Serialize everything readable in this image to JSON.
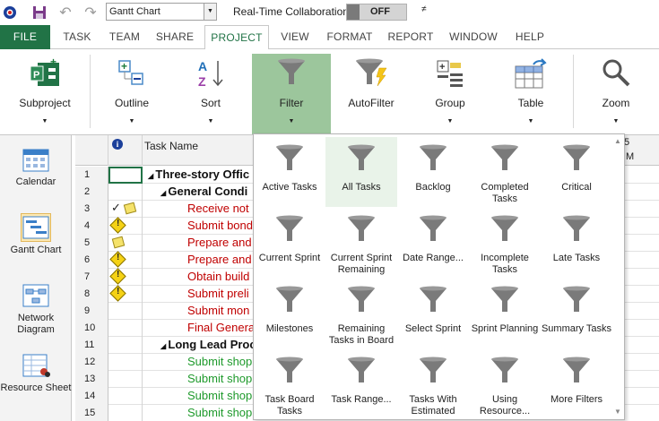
{
  "qat": {
    "view_select_value": "Gantt Chart",
    "realtime_label": "Real-Time Collaboration",
    "realtime_state": "OFF",
    "more_glyph": "≠"
  },
  "tabs": [
    "FILE",
    "TASK",
    "TEAM",
    "SHARE",
    "PROJECT",
    "VIEW",
    "FORMAT",
    "REPORT",
    "WINDOW",
    "HELP"
  ],
  "active_tab": "PROJECT",
  "ribbon": {
    "subproject": "Subproject",
    "outline": "Outline",
    "sort": "Sort",
    "filter": "Filter",
    "autofilter": "AutoFilter",
    "group": "Group",
    "table": "Table",
    "zoom": "Zoom"
  },
  "viewbar": {
    "calendar": "Calendar",
    "gantt": "Gantt Chart",
    "network": "Network Diagram",
    "resource": "Resource Sheet"
  },
  "grid": {
    "info_icon": "i",
    "task_name_header": "Task Name",
    "timescale_digit": "5",
    "timescale_letter": "M",
    "rows": [
      {
        "n": "1",
        "name": "Three-story Offic",
        "style": "summary",
        "indent": 0
      },
      {
        "n": "2",
        "name": "General Condi",
        "style": "summary",
        "indent": 1
      },
      {
        "n": "3",
        "name": "Receive not",
        "style": "red",
        "indent": 2
      },
      {
        "n": "4",
        "name": "Submit bond",
        "style": "red",
        "indent": 2
      },
      {
        "n": "5",
        "name": "Prepare and",
        "style": "red",
        "indent": 2
      },
      {
        "n": "6",
        "name": "Prepare and",
        "style": "red",
        "indent": 2
      },
      {
        "n": "7",
        "name": "Obtain build",
        "style": "red",
        "indent": 2
      },
      {
        "n": "8",
        "name": "Submit preli",
        "style": "red",
        "indent": 2
      },
      {
        "n": "9",
        "name": "Submit mon",
        "style": "red",
        "indent": 2
      },
      {
        "n": "10",
        "name": "Final Genera",
        "style": "red",
        "indent": 2
      },
      {
        "n": "11",
        "name": "Long Lead Proc",
        "style": "summary",
        "indent": 1
      },
      {
        "n": "12",
        "name": "Submit shop",
        "style": "green",
        "indent": 2
      },
      {
        "n": "13",
        "name": "Submit shop",
        "style": "green",
        "indent": 2
      },
      {
        "n": "14",
        "name": "Submit shop",
        "style": "green",
        "indent": 2
      },
      {
        "n": "15",
        "name": "Submit shop",
        "style": "green",
        "indent": 2
      }
    ]
  },
  "filter_menu": {
    "items": [
      [
        "Active Tasks",
        "All Tasks",
        "Backlog",
        "Completed Tasks",
        "Critical"
      ],
      [
        "Current Sprint",
        "Current Sprint Remaining",
        "Date Range...",
        "Incomplete Tasks",
        "Late Tasks"
      ],
      [
        "Milestones",
        "Remaining Tasks in Board",
        "Select Sprint",
        "Sprint Planning",
        "Summary Tasks"
      ],
      [
        "Task Board Tasks",
        "Task Range...",
        "Tasks With Estimated",
        "Using Resource...",
        "More Filters"
      ]
    ],
    "highlighted": "All Tasks"
  },
  "colors": {
    "accent": "#217346",
    "filter_pressed": "#9cc69c",
    "critical_text": "#c00000",
    "green_text": "#1f9a2c"
  }
}
